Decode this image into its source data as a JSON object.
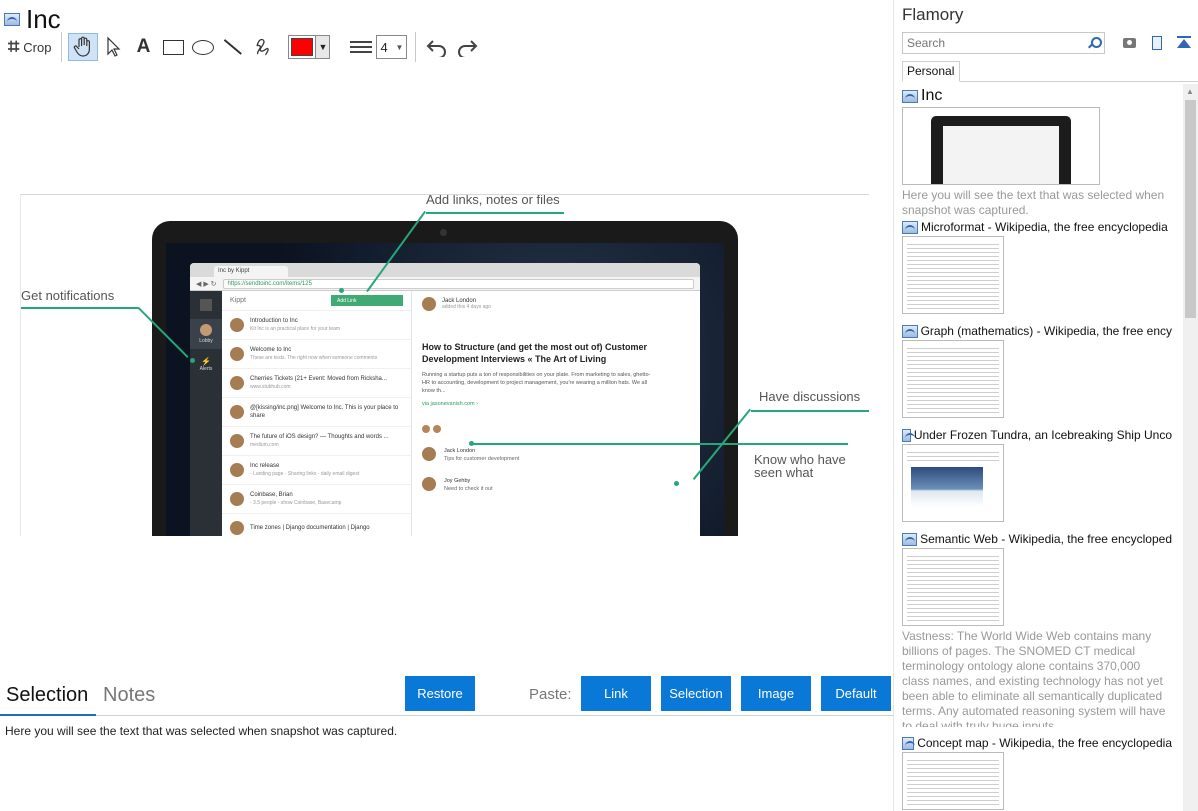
{
  "document": {
    "title": "Inc"
  },
  "toolbar": {
    "crop_label": "Crop",
    "stroke_color": "#ff0000",
    "line_width": "4"
  },
  "snapshot": {
    "callouts": {
      "add_links": "Add links, notes or files",
      "notifications": "Get notifications",
      "discussions": "Have discussions",
      "know_who": "Know who have seen what"
    },
    "browser": {
      "tab": "Inc by Kippt",
      "url": "https://sendtoinc.com/items/125"
    },
    "app": {
      "brand": "Kippt",
      "add_link": "Add Link",
      "rail": [
        "Lobby",
        "Alerts"
      ],
      "items": [
        {
          "title": "Introduction to Inc",
          "sub": "Kit Inc is an practical place for your team"
        },
        {
          "title": "Welcome to Inc",
          "sub": "These are tests. The right now when someone comments"
        },
        {
          "title": "Cherries Tickets (21+ Event: Moved from Ricksha...",
          "sub": "www.stubhub.com"
        },
        {
          "title": "@[kissing/inc.png] Welcome to Inc. This is your place to share",
          "sub": ""
        },
        {
          "title": "The future of iOS design? — Thoughts and words ...",
          "sub": "medium.com"
        },
        {
          "title": "Inc release",
          "sub": "- Landing page - Sharing links - daily email digest"
        },
        {
          "title": "Coinbase, Brian",
          "sub": "- 3.5 people - show Coinbase, Basecamp"
        },
        {
          "title": "Time zones | Django documentation | Django",
          "sub": ""
        }
      ],
      "detail": {
        "user": "Jack London",
        "added": "added this 4 days ago",
        "title": "How to Structure (and get the most out of) Customer Development Interviews « The Art of Living",
        "body": "Running a startup puts a ton of responsibilities on your plate. From marketing to sales, ghetto-HR to accounting, development to project management, you're wearing a million hats. We all know th...",
        "link": "via jasonevanish.com ›",
        "comments": [
          {
            "user": "Jack London",
            "text": "Tips for customer development"
          },
          {
            "user": "Joy Gehby",
            "text": "Need to check it out"
          }
        ]
      }
    }
  },
  "bottom": {
    "tab_selection": "Selection",
    "tab_notes": "Notes",
    "restore": "Restore",
    "paste_label": "Paste:",
    "paste_link": "Link",
    "paste_selection": "Selection",
    "paste_image": "Image",
    "paste_default": "Default",
    "selection_text": "Here you will see the text that was selected when snapshot was captured."
  },
  "sidebar": {
    "app_name": "Flamory",
    "search_placeholder": "Search",
    "tab": "Personal",
    "snapshots": [
      {
        "title": "Inc",
        "desc": "Here you will see the text that was selected when snapshot was captured."
      },
      {
        "title": "Microformat - Wikipedia, the free encyclopedia",
        "desc": ""
      },
      {
        "title": "Graph (mathematics) - Wikipedia, the free ency",
        "desc": ""
      },
      {
        "title": "Under Frozen Tundra, an Icebreaking Ship Unco",
        "desc": ""
      },
      {
        "title": "Semantic Web - Wikipedia, the free encycloped",
        "desc": "Vastness: The World Wide Web contains many billions of pages. The SNOMED CT medical terminology ontology alone contains 370,000 class names, and existing technology has not yet been able to eliminate all semantically duplicated terms. Any automated reasoning system will have to deal with truly huge inputs."
      },
      {
        "title": "Concept map - Wikipedia, the free encyclopedia",
        "desc": ""
      }
    ]
  },
  "colors": {
    "accent": "#0a78d7",
    "callout_green": "#27a67a",
    "stroke_color": "#ff0000"
  }
}
